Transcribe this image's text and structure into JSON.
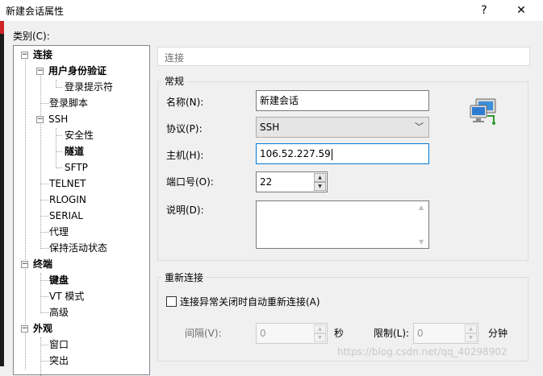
{
  "window": {
    "title": "新建会话属性",
    "help_label": "?",
    "close_label": "✕"
  },
  "category_label": "类别(C):",
  "tree": {
    "items": [
      {
        "label": "连接",
        "expander": "−"
      },
      {
        "label": "用户身份验证",
        "expander": "−"
      },
      {
        "label": "登录提示符"
      },
      {
        "label": "登录脚本"
      },
      {
        "label": "SSH",
        "expander": "−"
      },
      {
        "label": "安全性"
      },
      {
        "label": "隧道"
      },
      {
        "label": "SFTP"
      },
      {
        "label": "TELNET"
      },
      {
        "label": "RLOGIN"
      },
      {
        "label": "SERIAL"
      },
      {
        "label": "代理"
      },
      {
        "label": "保持活动状态"
      },
      {
        "label": "终端",
        "expander": "−"
      },
      {
        "label": "键盘"
      },
      {
        "label": "VT 模式"
      },
      {
        "label": "高级"
      },
      {
        "label": "外观",
        "expander": "−"
      },
      {
        "label": "窗口"
      },
      {
        "label": "突出"
      }
    ]
  },
  "panel": {
    "header": "连接",
    "general": {
      "title": "常规",
      "name_label": "名称(N):",
      "name_value": "新建会话",
      "protocol_label": "协议(P):",
      "protocol_value": "SSH",
      "protocol_arrow": "﹀",
      "host_label": "主机(H):",
      "host_value": "106.52.227.59",
      "port_label": "端口号(O):",
      "port_value": "22",
      "desc_label": "说明(D):",
      "desc_value": ""
    },
    "reconnect": {
      "title": "重新连接",
      "checkbox_label": "连接异常关闭时自动重新连接(A)",
      "interval_label": "间隔(V):",
      "interval_value": "0",
      "interval_unit": "秒",
      "limit_label": "限制(L):",
      "limit_value": "0",
      "limit_unit": "分钟"
    }
  },
  "watermark": "https://blog.csdn.net/qq_40298902"
}
